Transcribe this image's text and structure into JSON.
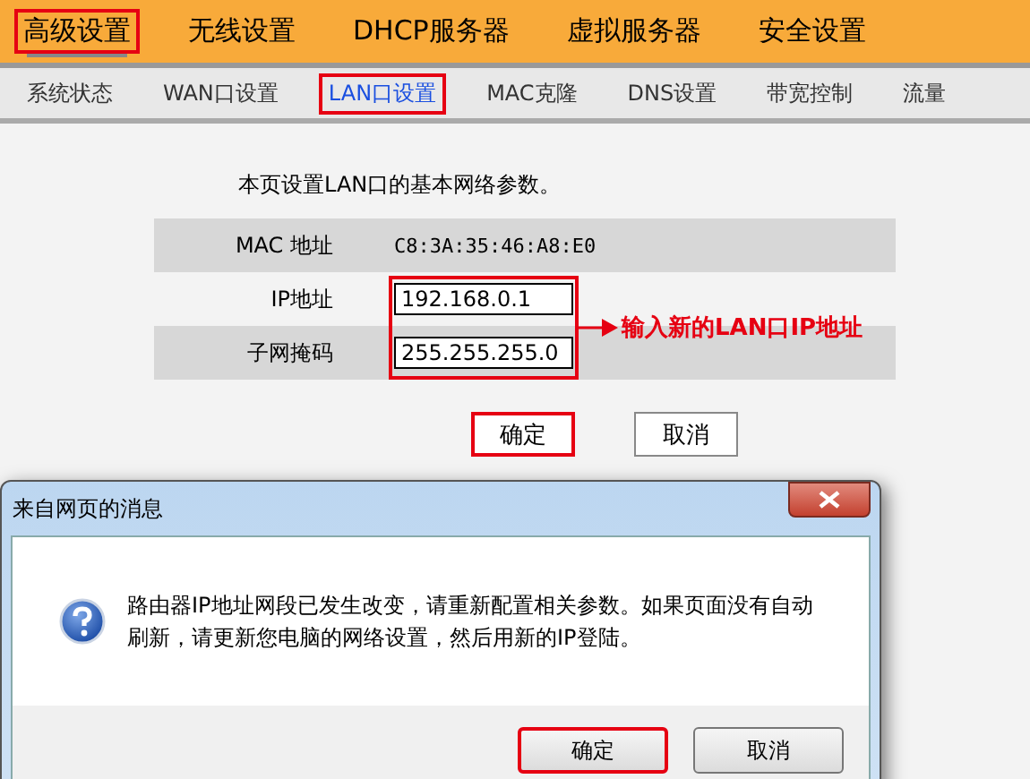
{
  "top_nav": [
    {
      "label": "高级设置",
      "selected": true,
      "highlighted": true
    },
    {
      "label": "无线设置",
      "selected": false,
      "highlighted": false
    },
    {
      "label": "DHCP服务器",
      "selected": false,
      "highlighted": false
    },
    {
      "label": "虚拟服务器",
      "selected": false,
      "highlighted": false
    },
    {
      "label": "安全设置",
      "selected": false,
      "highlighted": false
    }
  ],
  "sub_nav": [
    {
      "label": "系统状态",
      "selected": false,
      "highlighted": false
    },
    {
      "label": "WAN口设置",
      "selected": false,
      "highlighted": false
    },
    {
      "label": "LAN口设置",
      "selected": true,
      "highlighted": true
    },
    {
      "label": "MAC克隆",
      "selected": false,
      "highlighted": false
    },
    {
      "label": "DNS设置",
      "selected": false,
      "highlighted": false
    },
    {
      "label": "带宽控制",
      "selected": false,
      "highlighted": false
    },
    {
      "label": "流量",
      "selected": false,
      "highlighted": false
    }
  ],
  "intro": "本页设置LAN口的基本网络参数。",
  "fields": [
    {
      "kind": "static",
      "label": "MAC 地址",
      "value": "C8:3A:35:46:A8:E0"
    },
    {
      "kind": "input",
      "label": "IP地址",
      "value": "192.168.0.1"
    },
    {
      "kind": "input",
      "label": "子网掩码",
      "value": "255.255.255.0"
    }
  ],
  "annotation": "输入新的LAN口IP地址",
  "buttons": [
    {
      "label": "确定",
      "highlighted": true
    },
    {
      "label": "取消",
      "highlighted": false
    }
  ],
  "dialog": {
    "title": "来自网页的消息",
    "message": "路由器IP地址网段已发生改变，请重新配置相关参数。如果页面没有自动刷新，请更新您电脑的网络设置，然后用新的IP登陆。",
    "buttons": [
      {
        "label": "确定",
        "highlighted": true
      },
      {
        "label": "取消",
        "highlighted": false
      }
    ]
  }
}
